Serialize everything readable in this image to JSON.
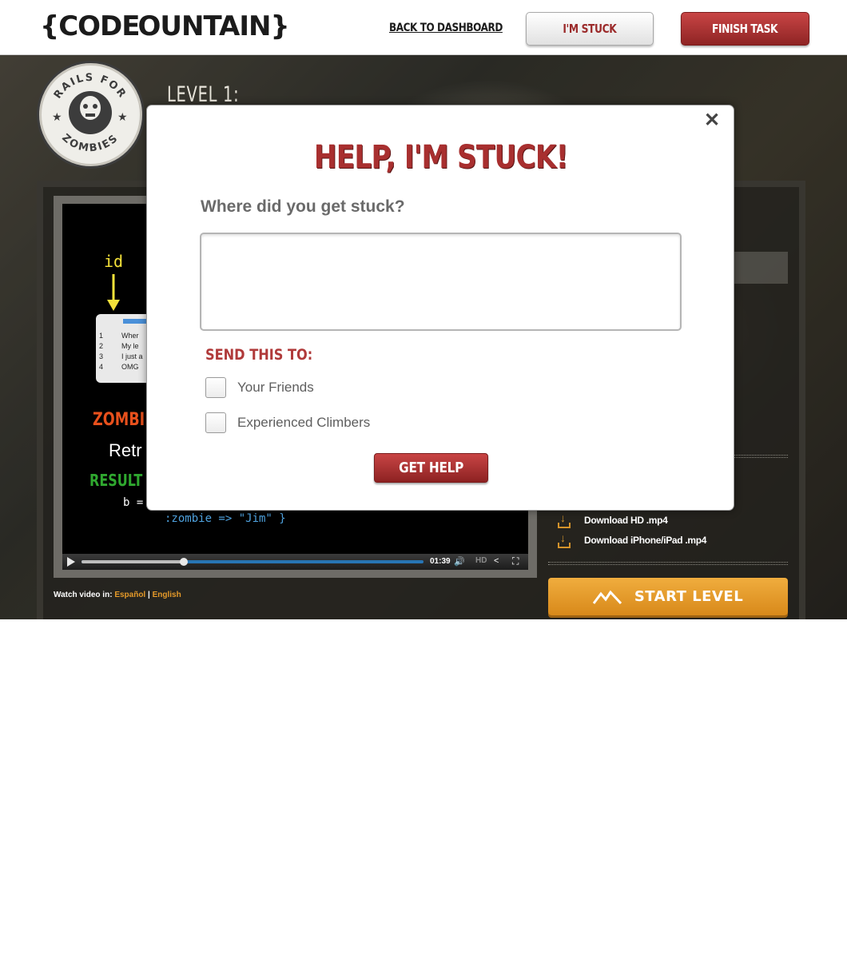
{
  "header": {
    "logo_left": "{CODE",
    "logo_right": "OUNTAIN}",
    "back_link": "BACK TO DASHBOARD",
    "stuck_button": "I'M STUCK",
    "finish_button": "FINISH TASK"
  },
  "course": {
    "badge_top": "RAILS FOR",
    "badge_bottom": "ZOMBIES",
    "level_title": "LEVEL 1:"
  },
  "video": {
    "code": {
      "id_label": "id",
      "table_rows": [
        {
          "num": "1",
          "text": "Wher"
        },
        {
          "num": "2",
          "text": "My le"
        },
        {
          "num": "3",
          "text": "I just a"
        },
        {
          "num": "4",
          "text": "OMG"
        }
      ],
      "zombie_label": "ZOMBIE",
      "retrieve_text": "Retr",
      "result_label": "RESULT",
      "b_line": "b =",
      "hash_line": ":zombie => \"Jim\" }"
    },
    "time": "01:39",
    "hd_label": "HD",
    "watch_label": "Watch video in:",
    "lang_es": "Español",
    "lang_en": "English"
  },
  "sidebar": {
    "downloads": [
      {
        "label": "Download HD .mp4",
        "icon": "download-icon"
      },
      {
        "label": "Download iPhone/iPad .mp4",
        "icon": "download-icon"
      }
    ],
    "start_button": "START LEVEL"
  },
  "modal": {
    "title": "HELP, I'M STUCK!",
    "question": "Where did you get stuck?",
    "textarea_value": "",
    "send_to_label": "SEND THIS TO:",
    "options": [
      {
        "label": "Your Friends",
        "checked": false
      },
      {
        "label": "Experienced Climbers",
        "checked": false
      }
    ],
    "submit": "GET HELP"
  },
  "colors": {
    "brand_red": "#a82f2f",
    "accent_orange": "#e59a29",
    "video_progress": "#2775b5"
  }
}
